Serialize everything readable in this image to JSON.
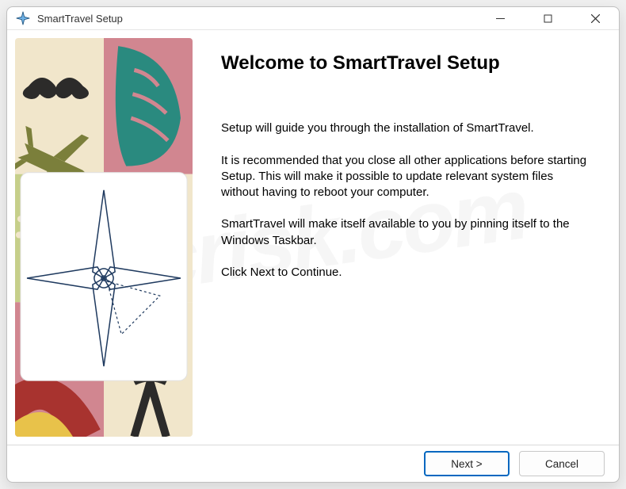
{
  "window": {
    "title": "SmartTravel Setup"
  },
  "main": {
    "heading": "Welcome to SmartTravel Setup",
    "para1": "Setup will guide you through the installation of SmartTravel.",
    "para2": "It is recommended that you close all other applications before starting Setup.  This will make it possible to update relevant system files without having to reboot your computer.",
    "para3": "SmartTravel will make itself available to you by pinning itself to the Windows Taskbar.",
    "para4": "Click Next to Continue."
  },
  "buttons": {
    "next": "Next >",
    "cancel": "Cancel"
  },
  "watermark": "pcrisk.com",
  "icons": {
    "app": "compass-icon",
    "minimize": "minimize-icon",
    "maximize": "maximize-icon",
    "close": "close-icon"
  },
  "colors": {
    "primary_border": "#0067c0",
    "sidebar_cream": "#f1e6cb",
    "sidebar_rose": "#d18690",
    "sidebar_teal": "#2a8a7f",
    "sidebar_olive": "#7b7f3b",
    "sidebar_navy": "#1f3a5f"
  }
}
